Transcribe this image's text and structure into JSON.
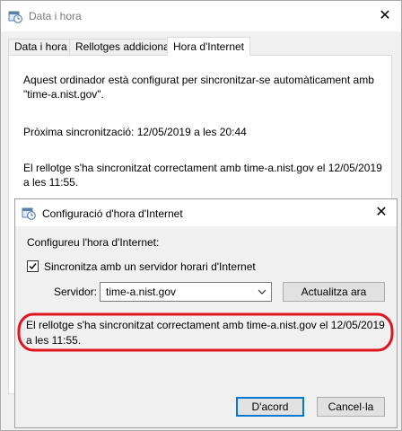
{
  "window": {
    "title": "Data i hora",
    "icon": "clock-calendar-icon",
    "close_symbol": "✕"
  },
  "tabs": [
    {
      "label": "Data i hora",
      "active": false
    },
    {
      "label": "Rellotges addicionals",
      "active": false
    },
    {
      "label": "Hora d'Internet",
      "active": true
    }
  ],
  "internet_tab": {
    "configured_text": "Aquest ordinador està configurat per sincronitzar-se automàticament amb \"time-a.nist.gov\".",
    "next_sync_text": "Pròxima sincronització: 12/05/2019 a les 20:44",
    "last_sync_text": "El rellotge s'ha sincronitzat correctament amb time-a.nist.gov el 12/05/2019 a les 11:55."
  },
  "dialog": {
    "title": "Configuració d'hora d'Internet",
    "icon": "clock-calendar-icon",
    "close_symbol": "✕",
    "heading": "Configureu l'hora d'Internet:",
    "sync_checkbox_label": "Sincronitza amb un servidor horari d'Internet",
    "sync_checked": true,
    "server_label": "Servidor:",
    "server_value": "time-a.nist.gov",
    "update_button": "Actualitza ara",
    "status_message": "El rellotge s'ha sincronitzat correctament amb time-a.nist.gov el 12/05/2019 a les 11:55.",
    "ok_button": "D'acord",
    "cancel_button": "Cancel·la",
    "highlight_color": "#e0141e",
    "accent_color": "#0078d7"
  }
}
